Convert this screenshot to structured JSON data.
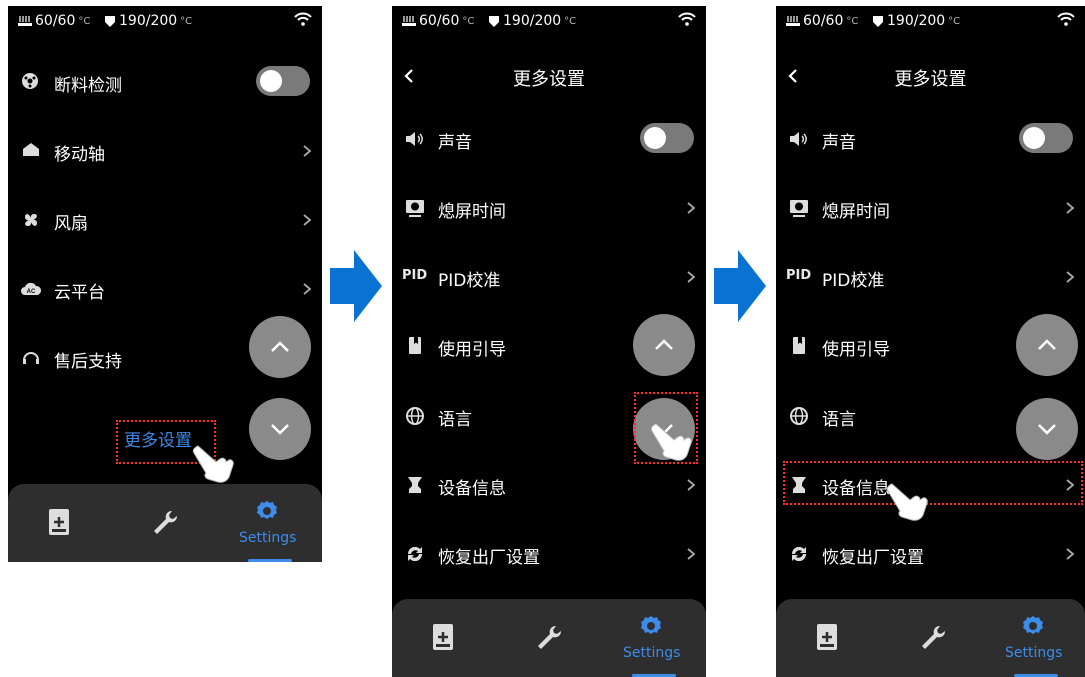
{
  "status": {
    "bed_temp": "60/60",
    "nozzle_temp": "190/200",
    "unit": "°C"
  },
  "screen1": {
    "items": [
      {
        "label": "断料检测"
      },
      {
        "label": "移动轴"
      },
      {
        "label": "风扇"
      },
      {
        "label": "云平台"
      },
      {
        "label": "售后支持"
      }
    ],
    "more_link": "更多设置"
  },
  "more_settings": {
    "title": "更多设置",
    "items": [
      {
        "label": "声音"
      },
      {
        "label": "熄屏时间"
      },
      {
        "label": "PID校准",
        "icon_text": "PID"
      },
      {
        "label": "使用引导"
      },
      {
        "label": "语言"
      },
      {
        "label": "设备信息"
      },
      {
        "label": "恢复出厂设置"
      }
    ]
  },
  "tabbar": {
    "settings_label": "Settings"
  },
  "colors": {
    "accent": "#3d8bea",
    "arrow": "#0a73d2",
    "highlight": "#ff2a2a",
    "round_button": "#8a8a8a",
    "tabbar": "#2e2e2e"
  }
}
